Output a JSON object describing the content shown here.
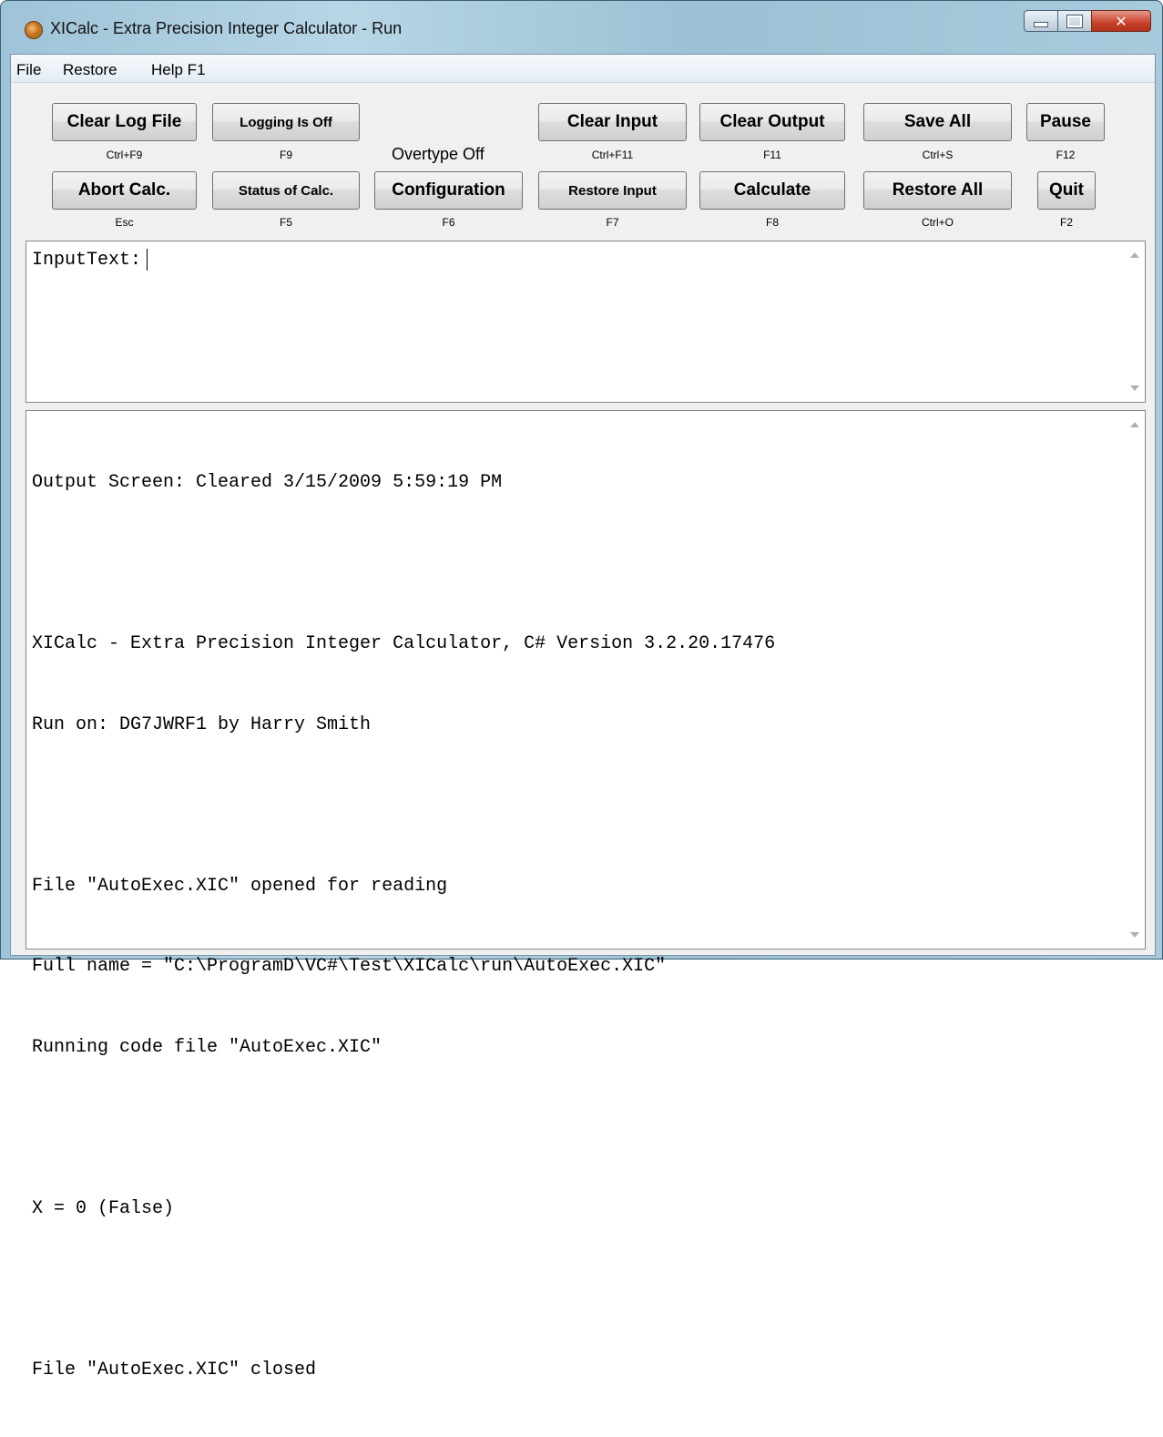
{
  "window": {
    "title": "XICalc - Extra Precision Integer Calculator - Run"
  },
  "menu": {
    "file": "File",
    "restore": "Restore",
    "help": "Help F1"
  },
  "toolbar": {
    "row1": [
      {
        "label": "Clear Log File",
        "key": "Ctrl+F9"
      },
      {
        "label": "Logging Is Off",
        "key": "F9"
      },
      {
        "label": "Clear Input",
        "key": "Ctrl+F11"
      },
      {
        "label": "Clear Output",
        "key": "F11"
      },
      {
        "label": "Save All",
        "key": "Ctrl+S"
      },
      {
        "label": "Pause",
        "key": "F12"
      }
    ],
    "overtype_status": "Overtype Off",
    "row2": [
      {
        "label": "Abort Calc.",
        "key": "Esc"
      },
      {
        "label": "Status of Calc.",
        "key": "F5"
      },
      {
        "label": "Configuration",
        "key": "F6"
      },
      {
        "label": "Restore Input",
        "key": "F7"
      },
      {
        "label": "Calculate",
        "key": "F8"
      },
      {
        "label": "Restore All",
        "key": "Ctrl+O"
      },
      {
        "label": "Quit",
        "key": "F2"
      }
    ]
  },
  "input": {
    "prompt": "InputText:"
  },
  "output": {
    "lines": [
      "Output Screen: Cleared 3/15/2009 5:59:19 PM",
      "",
      "XICalc - Extra Precision Integer Calculator, C# Version 3.2.20.17476",
      "Run on: DG7JWRF1 by Harry Smith",
      "",
      "File \"AutoExec.XIC\" opened for reading",
      "Full name = \"C:\\ProgramD\\VC#\\Test\\XICalc\\run\\AutoExec.XIC\"",
      "Running code file \"AutoExec.XIC\"",
      "",
      "X = 0 (False)",
      "",
      "File \"AutoExec.XIC\" closed"
    ]
  }
}
